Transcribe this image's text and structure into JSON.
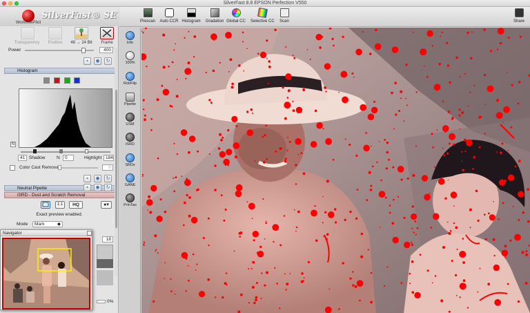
{
  "window": {
    "title": "SilverFast 8.8 EPSON Perfection V550"
  },
  "logo": {
    "text": "SilverFast® SE",
    "workflow_label": "WorkflowPilot"
  },
  "modes": [
    {
      "label": "Transparency"
    },
    {
      "label": "Positive"
    },
    {
      "label": "48 → 24 Bit"
    },
    {
      "label": "Frame"
    }
  ],
  "power": {
    "label": "Power",
    "value": "400",
    "level": 0.85
  },
  "histogram": {
    "title": "Histogram",
    "shadow_label": "Shadow",
    "shadow_value": "41",
    "n_label": "N",
    "n_value": "0",
    "highlight_label": "Highlight",
    "highlight_value": "184",
    "ccr_label": "Color Cast Removal",
    "ccr_value": "0"
  },
  "neutral_pipette": {
    "title": "Neutral Pipette"
  },
  "srd": {
    "title": "iSRD - Dust and Scratch Removal",
    "hq_label": "HQ",
    "status": "Exact preview enabled.",
    "mode_label": "Mode",
    "mode_value": "Mark",
    "value_18": "18",
    "percent": "0%"
  },
  "navigator": {
    "title": "Navigator"
  },
  "toolbar": [
    {
      "label": "Prescan",
      "icon": "prescan-icon"
    },
    {
      "label": "Auto CCR",
      "icon": "auto-ccr-icon"
    },
    {
      "label": "Histogram",
      "icon": "histogram-icon"
    },
    {
      "label": "Gradation",
      "icon": "gradation-icon"
    },
    {
      "label": "Global CC",
      "icon": "global-cc-icon"
    },
    {
      "label": "Selective CC",
      "icon": "selective-cc-icon"
    },
    {
      "label": "Scan",
      "icon": "scan-icon"
    }
  ],
  "share": {
    "label": "Share"
  },
  "tools": [
    {
      "label": "Info"
    },
    {
      "label": "100%"
    },
    {
      "label": "Rot/Flip"
    },
    {
      "label": "Pipette"
    },
    {
      "label": "USM"
    },
    {
      "label": "iSRD"
    },
    {
      "label": "SRDx"
    },
    {
      "label": "GANE"
    },
    {
      "label": "PrinTao"
    }
  ],
  "colors": {
    "accent": "#2a6db8",
    "dust_mark": "#ff0000",
    "frame_red": "#c00000"
  }
}
